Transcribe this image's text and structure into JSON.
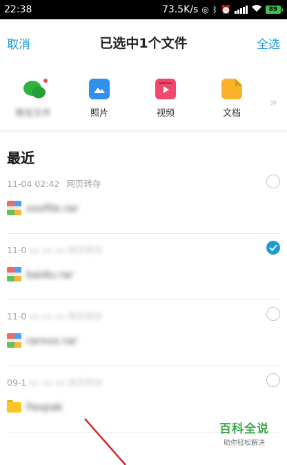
{
  "status_bar": {
    "time": "22:38",
    "network_speed": "73.5K/s",
    "battery": "89",
    "icons": [
      "hd-icon",
      "bluetooth-icon",
      "alarm-off-icon",
      "signal-icon",
      "wifi-icon",
      "battery-icon"
    ]
  },
  "header": {
    "cancel_label": "取消",
    "title": "已选中1个文件",
    "select_all_label": "全选"
  },
  "categories": [
    {
      "label": "微信文件",
      "icon": "wechat-icon",
      "color": "#2bb33d",
      "blurred": true,
      "badge": true
    },
    {
      "label": "照片",
      "icon": "photo-icon",
      "color": "#2f90f0"
    },
    {
      "label": "视频",
      "icon": "video-icon",
      "color": "#f0476a"
    },
    {
      "label": "文档",
      "icon": "document-icon",
      "color": "#fbb12a"
    }
  ],
  "more_icon": "double-chevron-right-icon",
  "section_title": "最近",
  "items": [
    {
      "time": "11-04 02:42",
      "source": "网页转存",
      "source_blurred": false,
      "name": "xxxfile.rar",
      "icon": "archive-icon",
      "checked": false
    },
    {
      "time": "11-0",
      "source": "xx xx xx 网页转存",
      "source_blurred": true,
      "name": "baidu.rar",
      "icon": "archive-icon",
      "checked": true
    },
    {
      "time": "11-0",
      "source": "xx xx xx 网页转存",
      "source_blurred": true,
      "name": "rarxxx.rar",
      "icon": "archive-icon",
      "checked": false
    },
    {
      "time": "09-1",
      "source": "xx xx xx 网页转存",
      "source_blurred": true,
      "name": "Faxpak",
      "icon": "folder-icon",
      "checked": false
    }
  ],
  "watermark": {
    "title": "百科全说",
    "subtitle": "助你轻松解决"
  },
  "colors": {
    "accent": "#1c9ad6",
    "watermark_green": "#3aa845",
    "pointer_red": "#d62424"
  }
}
